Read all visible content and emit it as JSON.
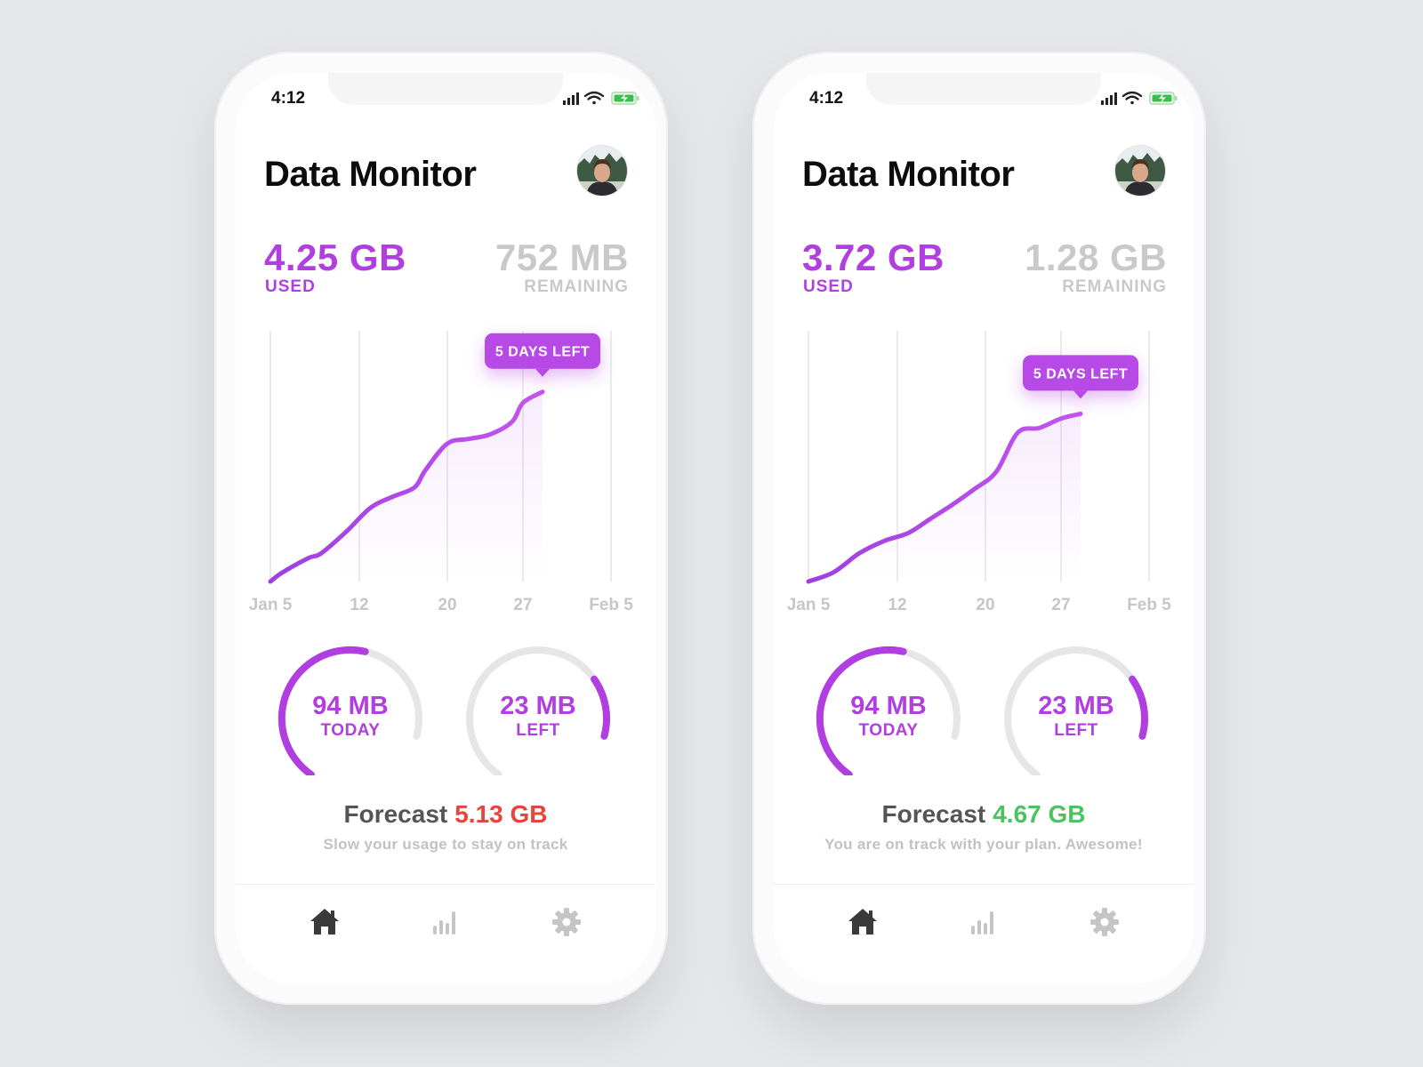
{
  "colors": {
    "accent": "#b03ee0",
    "accent_light": "#c85cf0",
    "muted": "#c9c9c9",
    "track": "#e6e6e6",
    "forecast_over": "#e5453d",
    "forecast_ok": "#4cc35f",
    "tab_active": "#3a3a3a",
    "tab_inactive": "#c5c5c5"
  },
  "phones": [
    {
      "status": {
        "time": "4:12"
      },
      "title": "Data Monitor",
      "avatar": "user-avatar-photo",
      "used": {
        "value": "4.25 GB",
        "label": "USED"
      },
      "remaining": {
        "value": "752 MB",
        "label": "REMAINING"
      },
      "chart_data": {
        "type": "line",
        "x_ticks": [
          "Jan 5",
          "12",
          "20",
          "27",
          "Feb 5"
        ],
        "x": [
          "Jan 5",
          "Jan 6",
          "Jan 8",
          "Jan 9",
          "Jan 11",
          "Jan 13",
          "Jan 15",
          "Jan 17",
          "Jan 18",
          "Jan 20",
          "Jan 22",
          "Jan 24",
          "Jan 26",
          "Jan 27",
          "Jan 29"
        ],
        "y": [
          0.0,
          0.3,
          0.75,
          0.9,
          1.6,
          2.35,
          2.7,
          3.0,
          3.55,
          4.4,
          4.55,
          4.7,
          5.1,
          5.7,
          6.05
        ],
        "ylim": [
          0,
          8
        ],
        "grid": "vertical",
        "tooltip": "5 DAYS LEFT"
      },
      "gauges": [
        {
          "value": "94 MB",
          "label": "TODAY",
          "fraction": 0.63
        },
        {
          "value": "23 MB",
          "label": "LEFT",
          "fraction": 0.2
        }
      ],
      "forecast": {
        "label": "Forecast",
        "value": "5.13 GB",
        "status": "over",
        "message": "Slow your usage to stay on track"
      },
      "tabs": [
        {
          "icon": "home-icon",
          "active": true
        },
        {
          "icon": "bar-chart-icon",
          "active": false
        },
        {
          "icon": "gear-icon",
          "active": false
        }
      ]
    },
    {
      "status": {
        "time": "4:12"
      },
      "title": "Data Monitor",
      "avatar": "user-avatar-photo",
      "used": {
        "value": "3.72 GB",
        "label": "USED"
      },
      "remaining": {
        "value": "1.28 GB",
        "label": "REMAINING"
      },
      "chart_data": {
        "type": "line",
        "x_ticks": [
          "Jan 5",
          "12",
          "20",
          "27",
          "Feb 5"
        ],
        "x": [
          "Jan 5",
          "Jan 7",
          "Jan 9",
          "Jan 11",
          "Jan 13",
          "Jan 15",
          "Jan 17",
          "Jan 19",
          "Jan 21",
          "Jan 23",
          "Jan 25",
          "Jan 27",
          "Jan 29"
        ],
        "y": [
          0.0,
          0.3,
          0.9,
          1.3,
          1.55,
          2.0,
          2.45,
          2.95,
          3.5,
          4.75,
          4.9,
          5.2,
          5.35
        ],
        "ylim": [
          0,
          8
        ],
        "grid": "vertical",
        "tooltip": "5 DAYS LEFT"
      },
      "gauges": [
        {
          "value": "94 MB",
          "label": "TODAY",
          "fraction": 0.63
        },
        {
          "value": "23 MB",
          "label": "LEFT",
          "fraction": 0.2
        }
      ],
      "forecast": {
        "label": "Forecast",
        "value": "4.67 GB",
        "status": "ok",
        "message": "You are on track with your plan. Awesome!"
      },
      "tabs": [
        {
          "icon": "home-icon",
          "active": true
        },
        {
          "icon": "bar-chart-icon",
          "active": false
        },
        {
          "icon": "gear-icon",
          "active": false
        }
      ]
    }
  ]
}
